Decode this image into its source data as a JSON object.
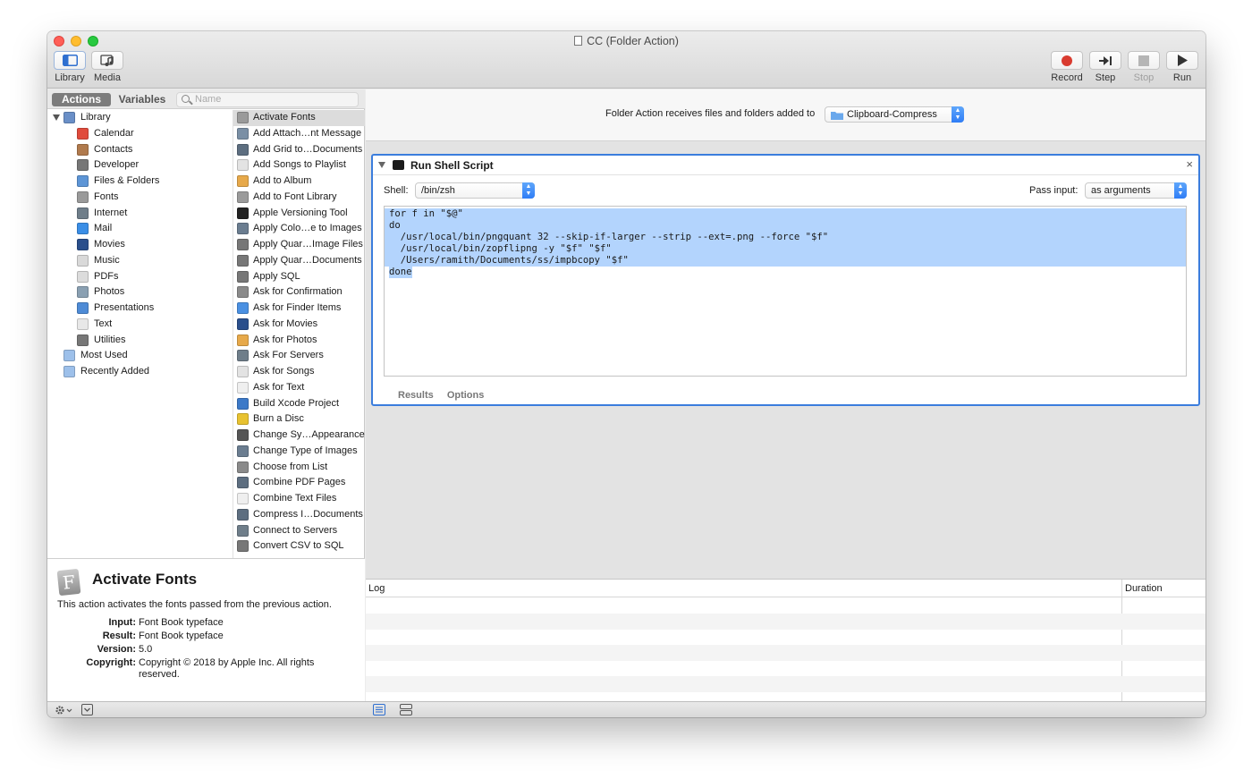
{
  "window": {
    "title": "CC (Folder Action)"
  },
  "toolbar": {
    "library_label": "Library",
    "media_label": "Media",
    "record_label": "Record",
    "step_label": "Step",
    "stop_label": "Stop",
    "run_label": "Run"
  },
  "library_tabs": {
    "actions": "Actions",
    "variables": "Variables"
  },
  "search": {
    "placeholder": "Name"
  },
  "categories": [
    {
      "label": "Library",
      "icon": "library-icon",
      "color": "#6a8fc7"
    },
    {
      "label": "Calendar",
      "icon": "calendar-icon",
      "color": "#e04b3c"
    },
    {
      "label": "Contacts",
      "icon": "contacts-icon",
      "color": "#b07a4d"
    },
    {
      "label": "Developer",
      "icon": "developer-icon",
      "color": "#777777"
    },
    {
      "label": "Files & Folders",
      "icon": "files-folders-icon",
      "color": "#5d95d6"
    },
    {
      "label": "Fonts",
      "icon": "fonts-icon",
      "color": "#9a9a9a"
    },
    {
      "label": "Internet",
      "icon": "internet-icon",
      "color": "#6f7e8a"
    },
    {
      "label": "Mail",
      "icon": "mail-icon",
      "color": "#3a8ee6"
    },
    {
      "label": "Movies",
      "icon": "movies-icon",
      "color": "#2a4f8c"
    },
    {
      "label": "Music",
      "icon": "music-icon",
      "color": "#d9d9d9"
    },
    {
      "label": "PDFs",
      "icon": "pdfs-icon",
      "color": "#dcdcdc"
    },
    {
      "label": "Photos",
      "icon": "photos-icon",
      "color": "#8aa0b2"
    },
    {
      "label": "Presentations",
      "icon": "presentations-icon",
      "color": "#4e8bd6"
    },
    {
      "label": "Text",
      "icon": "text-icon",
      "color": "#e8e8e8"
    },
    {
      "label": "Utilities",
      "icon": "utilities-icon",
      "color": "#777777"
    },
    {
      "label": "Most Used",
      "icon": "most-used-folder-icon",
      "color": "#9dc0ea"
    },
    {
      "label": "Recently Added",
      "icon": "recently-added-folder-icon",
      "color": "#9dc0ea"
    }
  ],
  "actions": [
    {
      "label": "Activate Fonts",
      "icon": "fonts-icon",
      "color": "#9a9a9a"
    },
    {
      "label": "Add Attach…nt Message",
      "icon": "mail-icon",
      "color": "#7a8fa5"
    },
    {
      "label": "Add Grid to…Documents",
      "icon": "pdf-icon",
      "color": "#5d6e80"
    },
    {
      "label": "Add Songs to Playlist",
      "icon": "music-icon",
      "color": "#e3e3e3"
    },
    {
      "label": "Add to Album",
      "icon": "photos-icon",
      "color": "#e7a94a"
    },
    {
      "label": "Add to Font Library",
      "icon": "fonts-icon",
      "color": "#9a9a9a"
    },
    {
      "label": "Apple Versioning Tool",
      "icon": "terminal-icon",
      "color": "#222222"
    },
    {
      "label": "Apply Colo…e to Images",
      "icon": "image-icon",
      "color": "#6b7d90"
    },
    {
      "label": "Apply Quar…Image Files",
      "icon": "utilities-icon",
      "color": "#777777"
    },
    {
      "label": "Apply Quar…Documents",
      "icon": "utilities-icon",
      "color": "#777777"
    },
    {
      "label": "Apply SQL",
      "icon": "utilities-icon",
      "color": "#777777"
    },
    {
      "label": "Ask for Confirmation",
      "icon": "pen-icon",
      "color": "#8a8a8a"
    },
    {
      "label": "Ask for Finder Items",
      "icon": "finder-icon",
      "color": "#4a90e2"
    },
    {
      "label": "Ask for Movies",
      "icon": "movies-icon",
      "color": "#2a4f8c"
    },
    {
      "label": "Ask for Photos",
      "icon": "photos-icon",
      "color": "#e7a94a"
    },
    {
      "label": "Ask For Servers",
      "icon": "internet-icon",
      "color": "#6f7e8a"
    },
    {
      "label": "Ask for Songs",
      "icon": "music-icon",
      "color": "#e3e3e3"
    },
    {
      "label": "Ask for Text",
      "icon": "text-icon",
      "color": "#efefef"
    },
    {
      "label": "Build Xcode Project",
      "icon": "xcode-icon",
      "color": "#3c79c8"
    },
    {
      "label": "Burn a Disc",
      "icon": "burn-icon",
      "color": "#e8c230"
    },
    {
      "label": "Change Sy…Appearance",
      "icon": "appearance-icon",
      "color": "#555555"
    },
    {
      "label": "Change Type of Images",
      "icon": "image-icon",
      "color": "#6b7d90"
    },
    {
      "label": "Choose from List",
      "icon": "pen-icon",
      "color": "#8a8a8a"
    },
    {
      "label": "Combine PDF Pages",
      "icon": "pdf-icon",
      "color": "#5d6e80"
    },
    {
      "label": "Combine Text Files",
      "icon": "text-icon",
      "color": "#efefef"
    },
    {
      "label": "Compress I…Documents",
      "icon": "pdf-icon",
      "color": "#5d6e80"
    },
    {
      "label": "Connect to Servers",
      "icon": "internet-icon",
      "color": "#6f7e8a"
    },
    {
      "label": "Convert CSV to SQL",
      "icon": "utilities-icon",
      "color": "#777777"
    }
  ],
  "description": {
    "title": "Activate Fonts",
    "icon_letter": "F",
    "summary": "This action activates the fonts passed from the previous action.",
    "input_key": "Input:",
    "input_value": "Font Book typeface",
    "result_key": "Result:",
    "result_value": "Font Book typeface",
    "version_key": "Version:",
    "version_value": "5.0",
    "copyright_key": "Copyright:",
    "copyright_value": "Copyright © 2018 by Apple Inc. All rights reserved."
  },
  "workflow": {
    "receives_label": "Folder Action receives files and folders added to",
    "folder_value": "Clipboard-Compress"
  },
  "shell_action": {
    "title": "Run Shell Script",
    "close_glyph": "×",
    "shell_label": "Shell:",
    "shell_value": "/bin/zsh",
    "pass_input_label": "Pass input:",
    "pass_input_value": "as arguments",
    "code_lines": [
      "for f in \"$@\"",
      "do",
      "  /usr/local/bin/pngquant 32 --skip-if-larger --strip --ext=.png --force \"$f\"",
      "  /usr/local/bin/zopflipng -y \"$f\" \"$f\"",
      "  /Users/ramith/Documents/ss/impbcopy \"$f\"",
      "done"
    ],
    "tab_results": "Results",
    "tab_options": "Options"
  },
  "log": {
    "col_log": "Log",
    "col_duration": "Duration"
  },
  "colors": {
    "accent": "#3b7ddd",
    "selection": "#b3d4fd",
    "record": "#d93b2f"
  }
}
